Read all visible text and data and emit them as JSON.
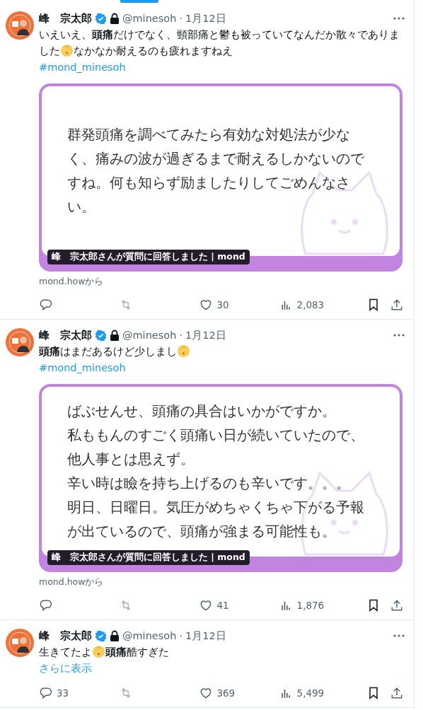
{
  "tweets": [
    {
      "author": "峰　宗太郎",
      "verified": true,
      "locked": true,
      "handle": "@minesoh",
      "separator": "·",
      "date": "1月12日",
      "segments": [
        {
          "kind": "text",
          "text": "いえいえ、**頭痛**だけでなく、頸部痛と鬱も被っていてなんだか散々でありま"
        },
        {
          "kind": "break"
        },
        {
          "kind": "text",
          "text": "した"
        },
        {
          "kind": "emoji"
        },
        {
          "kind": "text",
          "text": "なかなか耐えるのも疲れますねえ"
        }
      ],
      "hashtag": "#mond_minesoh",
      "card": {
        "lines": [
          "群発頭痛を調べてみたら有効な対処法が少な",
          "く、痛みの波が過ぎるまで耐えるしかないので",
          "すね。何も知らず励ましたりしてごめんなさ",
          "い。"
        ],
        "caption": "峰　宗太郎さんが質問に回答しました | mond"
      },
      "source": "mond.howから",
      "actions": [
        {
          "kind": "reply"
        },
        {
          "kind": "retweet"
        },
        {
          "kind": "like",
          "count": "30"
        },
        {
          "kind": "views",
          "count": "2,083"
        },
        {
          "kind": "bookmark"
        },
        {
          "kind": "share"
        }
      ]
    },
    {
      "author": "峰　宗太郎",
      "verified": true,
      "locked": true,
      "handle": "@minesoh",
      "separator": "·",
      "date": "1月12日",
      "segments": [
        {
          "kind": "text",
          "text": "**頭痛**はまだあるけど少しまし"
        },
        {
          "kind": "emoji"
        }
      ],
      "hashtag": "#mond_minesoh",
      "card": {
        "lines": [
          "ばぶせんせ、頭痛の具合はいかがですか。",
          "私ももんのすごく頭痛い日が続いていたので、",
          "他人事とは思えず。",
          "辛い時は瞼を持ち上げるのも辛いです。。。",
          "明日、日曜日。気圧がめちゃくちゃ下がる予報",
          "が出ているので、頭痛が強まる可能性も。"
        ],
        "caption": "峰　宗太郎さんが質問に回答しました | mond"
      },
      "source": "mond.howから",
      "actions": [
        {
          "kind": "reply"
        },
        {
          "kind": "retweet"
        },
        {
          "kind": "like",
          "count": "41"
        },
        {
          "kind": "views",
          "count": "1,876"
        },
        {
          "kind": "bookmark"
        },
        {
          "kind": "share"
        }
      ]
    },
    {
      "author": "峰　宗太郎",
      "verified": true,
      "locked": true,
      "handle": "@minesoh",
      "separator": "·",
      "date": "1月12日",
      "segments": [
        {
          "kind": "text",
          "text": "生きてたよ"
        },
        {
          "kind": "emoji"
        },
        {
          "kind": "text",
          "text": "**頭痛**酷すぎた"
        }
      ],
      "more_link": "さらに表示",
      "actions": [
        {
          "kind": "reply",
          "count": "33"
        },
        {
          "kind": "retweet"
        },
        {
          "kind": "like",
          "count": "369"
        },
        {
          "kind": "views",
          "count": "5,499"
        },
        {
          "kind": "bookmark"
        },
        {
          "kind": "share"
        }
      ]
    }
  ]
}
